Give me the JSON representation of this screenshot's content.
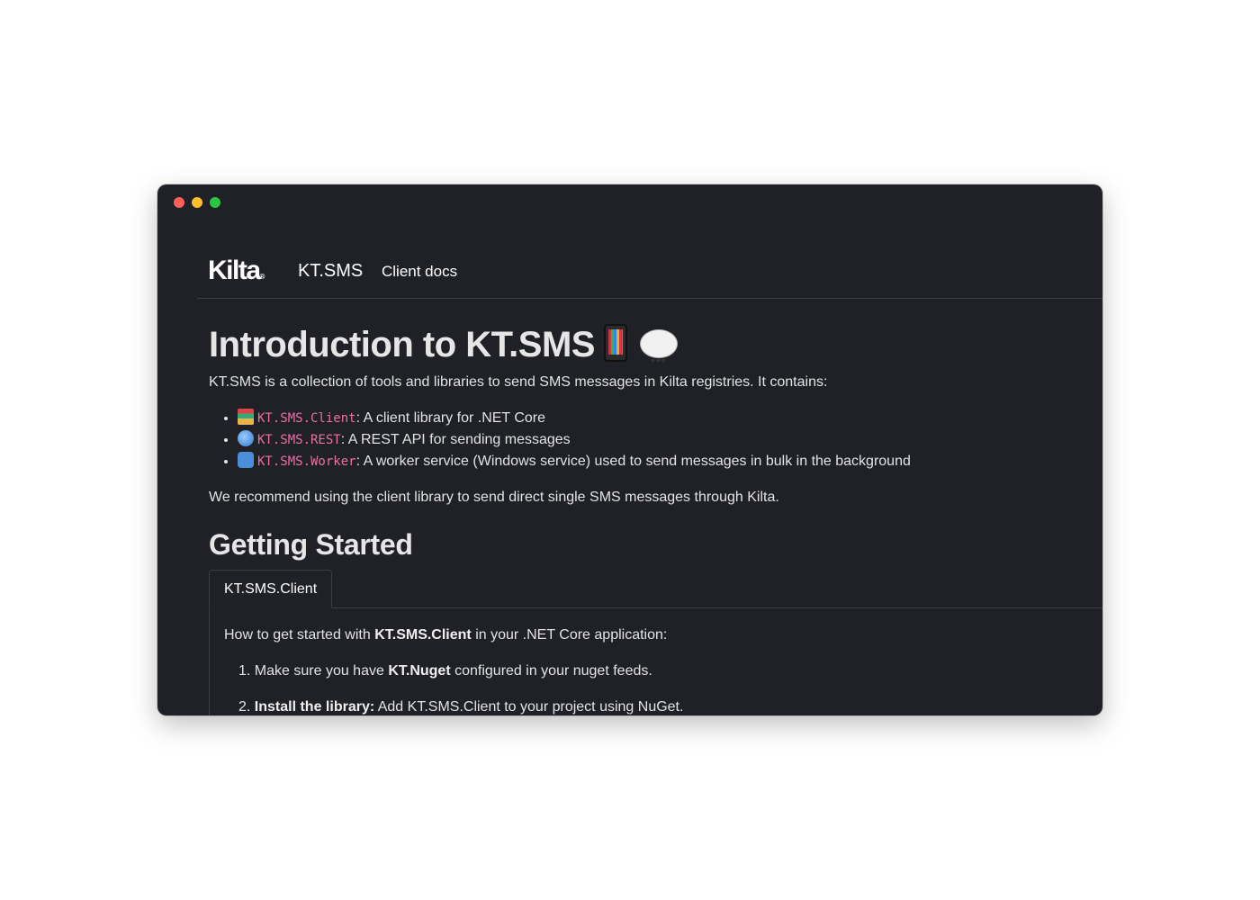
{
  "window": {
    "controls": [
      "close",
      "minimize",
      "maximize"
    ]
  },
  "navbar": {
    "logo": "Kilta",
    "logo_mark": "®",
    "brand": "KT.SMS",
    "link": "Client docs"
  },
  "page": {
    "title": "Introduction to KT.SMS",
    "title_icons": [
      "mobile-phone-icon",
      "speech-bubble-icon"
    ],
    "intro": "KT.SMS is a collection of tools and libraries to send SMS messages in Kilta registries. It contains:",
    "features": [
      {
        "icon": "books-icon",
        "code": "KT.SMS.Client",
        "text": ": A client library for .NET Core"
      },
      {
        "icon": "globe-icon",
        "code": "KT.SMS.REST",
        "text": ": A REST API for sending messages"
      },
      {
        "icon": "cycle-icon",
        "code": "KT.SMS.Worker",
        "text": ": A worker service (Windows service) used to send messages in bulk in the background"
      }
    ],
    "recommend": "We recommend using the client library to send direct single SMS messages through Kilta.",
    "getting_started": "Getting Started",
    "tab": "KT.SMS.Client",
    "panel": {
      "intro_pre": "How to get started with ",
      "intro_bold": "KT.SMS.Client",
      "intro_post": " in your .NET Core application:",
      "steps": [
        {
          "num": "1.",
          "pre": "Make sure you have ",
          "bold": "KT.Nuget",
          "post": " configured in your nuget feeds."
        },
        {
          "num": "2.",
          "pre": "",
          "bold": "Install the library:",
          "post": " Add KT.SMS.Client to your project using NuGet."
        }
      ]
    }
  }
}
